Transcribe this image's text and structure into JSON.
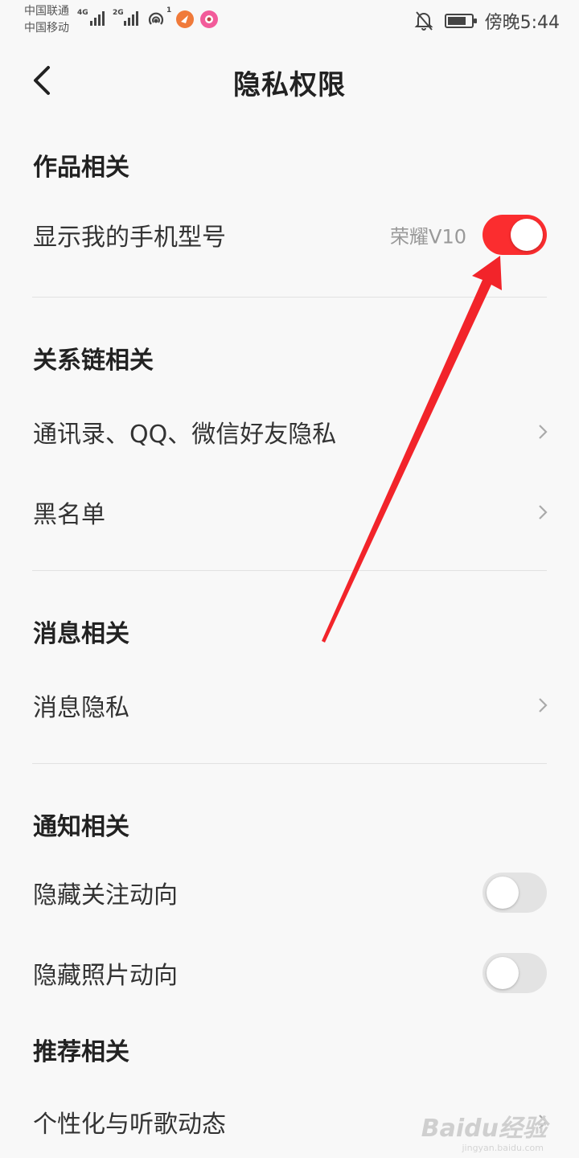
{
  "status_bar": {
    "carrier_1": "中国联通",
    "carrier_2": "中国移动",
    "signal_1_type": "4G",
    "signal_2_type": "2G",
    "hotspot_count": "1",
    "time": "傍晚5:44"
  },
  "header": {
    "title": "隐私权限"
  },
  "sections": {
    "works": {
      "title": "作品相关",
      "show_model_label": "显示我的手机型号",
      "show_model_value": "荣耀V10",
      "show_model_on": true
    },
    "relations": {
      "title": "关系链相关",
      "contacts_label": "通讯录、QQ、微信好友隐私",
      "blacklist_label": "黑名单"
    },
    "messages": {
      "title": "消息相关",
      "message_privacy_label": "消息隐私"
    },
    "notifications": {
      "title": "通知相关",
      "hide_follow_label": "隐藏关注动向",
      "hide_follow_on": false,
      "hide_photo_label": "隐藏照片动向",
      "hide_photo_on": false
    },
    "recommend": {
      "title": "推荐相关",
      "personalize_label": "个性化与听歌动态"
    }
  },
  "watermark": {
    "text": "Baidu经验",
    "sub": "jingyan.baidu.com"
  },
  "colors": {
    "accent": "#fb2d2f",
    "background": "#f8f8f8",
    "toggle_off": "#e3e3e3"
  }
}
